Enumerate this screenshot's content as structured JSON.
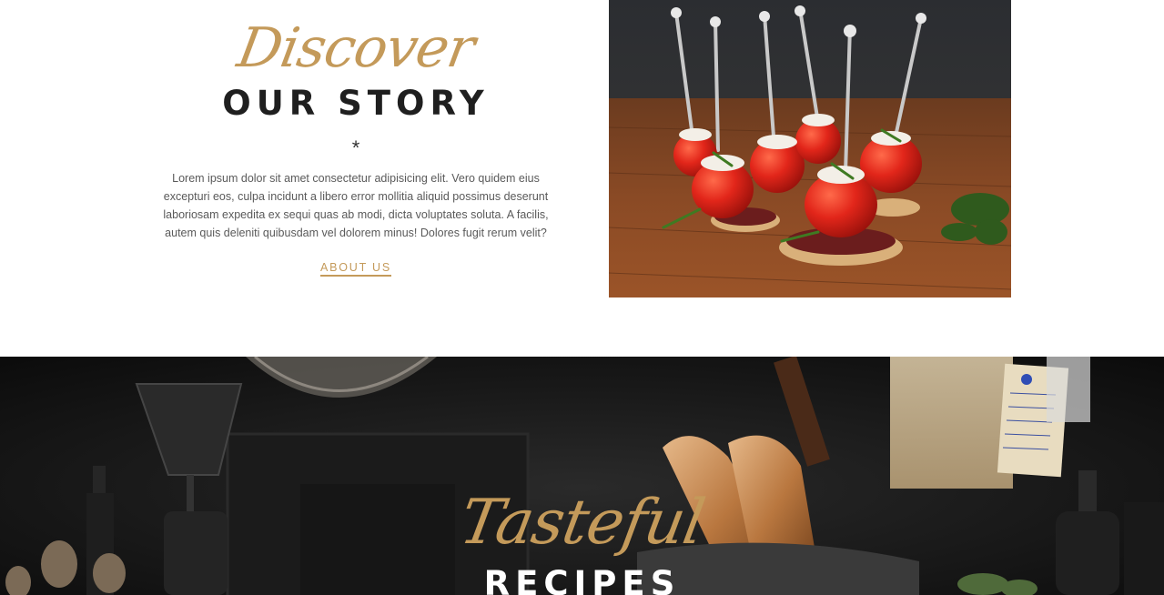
{
  "story": {
    "script_title": "Discover",
    "heading": "OUR STORY",
    "divider": "*",
    "body": "Lorem ipsum dolor sit amet consectetur adipisicing elit. Vero quidem eius excepturi eos, culpa incidunt a libero error mollitia aliquid possimus deserunt laboriosam expedita ex sequi quas ab modi, dicta voluptates soluta. A facilis, autem quis deleniti quibusdam vel dolorem minus! Dolores fugit rerum velit?",
    "link_label": "ABOUT US"
  },
  "recipes": {
    "script_title": "Tasteful",
    "heading": "RECIPES"
  },
  "colors": {
    "accent": "#c49a5a",
    "heading": "#1f1f1f",
    "body_text": "#5a5a5a",
    "dark_band": "#141414"
  }
}
